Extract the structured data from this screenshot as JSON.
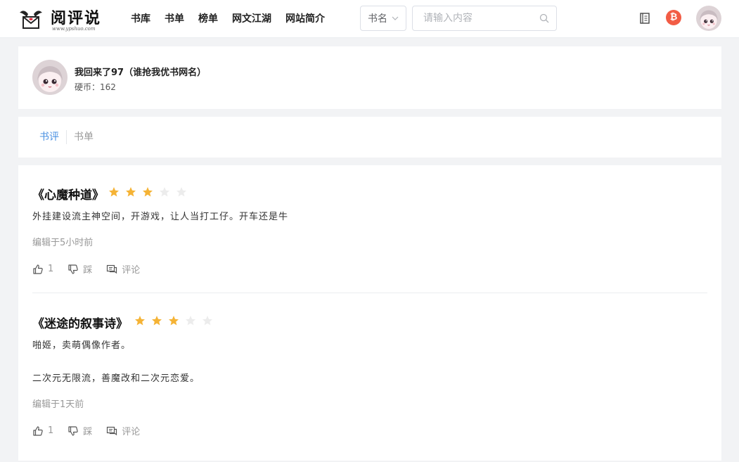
{
  "header": {
    "logo_text": "阅评说",
    "logo_sub": "www.ypshuo.com",
    "nav": [
      "书库",
      "书单",
      "榜单",
      "网文江湖",
      "网站简介"
    ],
    "search_type": "书名",
    "search_placeholder": "请输入内容",
    "coin_symbol": "₿"
  },
  "profile": {
    "name": "我回来了97（谁抢我优书网名）",
    "coins": "硬币：162"
  },
  "tabs": {
    "active": "书评",
    "inactive": "书单"
  },
  "reviews": [
    {
      "title": "《心魔种道》",
      "rating": 3,
      "max_rating": 5,
      "lines": [
        "外挂建设流主神空间，开游戏，让人当打工仔。开车还是牛"
      ],
      "time": "编辑于5小时前",
      "likes": "1",
      "dislike_label": "踩",
      "comment_label": "评论"
    },
    {
      "title": "《迷途的叙事诗》",
      "rating": 3,
      "max_rating": 5,
      "lines": [
        "啪姬，卖萌偶像作者。",
        "二次元无限流，善魔改和二次元恋爱。"
      ],
      "time": "编辑于1天前",
      "likes": "1",
      "dislike_label": "踩",
      "comment_label": "评论"
    }
  ],
  "colors": {
    "accent": "#4a90e2",
    "star_on": "#f5b335",
    "star_off": "#ececec",
    "coin": "#f25c45"
  }
}
